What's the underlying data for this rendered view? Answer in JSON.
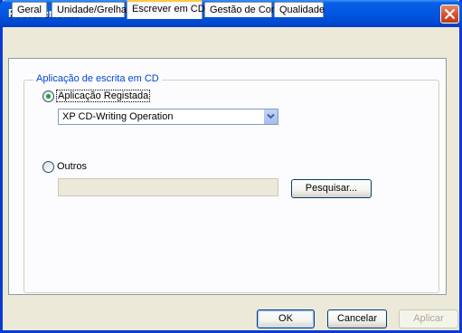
{
  "window": {
    "title": "Preferências"
  },
  "tabs": [
    {
      "label": "Geral",
      "active": false
    },
    {
      "label": "Unidade/Grelha",
      "active": false
    },
    {
      "label": "Escrever em CD",
      "active": true
    },
    {
      "label": "Gestão de Cor",
      "active": false
    },
    {
      "label": "Qualidade",
      "active": false
    }
  ],
  "group": {
    "legend": "Aplicação de escrita em CD",
    "registered": {
      "label": "Aplicação Registada",
      "selected": true,
      "dropdown_value": "XP CD-Writing Operation"
    },
    "other": {
      "label": "Outros",
      "selected": false,
      "path_value": "",
      "browse_label": "Pesquisar..."
    }
  },
  "footer": {
    "ok_label": "OK",
    "cancel_label": "Cancelar",
    "apply_label": "Aplicar"
  },
  "colors": {
    "titlebar": "#0256e0",
    "close": "#d44a22",
    "tab_highlight": "#ffc83c",
    "legend_text": "#0046d5",
    "radio_dot": "#21a121"
  },
  "icons": {
    "close": "close-icon",
    "dropdown": "chevron-down-icon"
  }
}
